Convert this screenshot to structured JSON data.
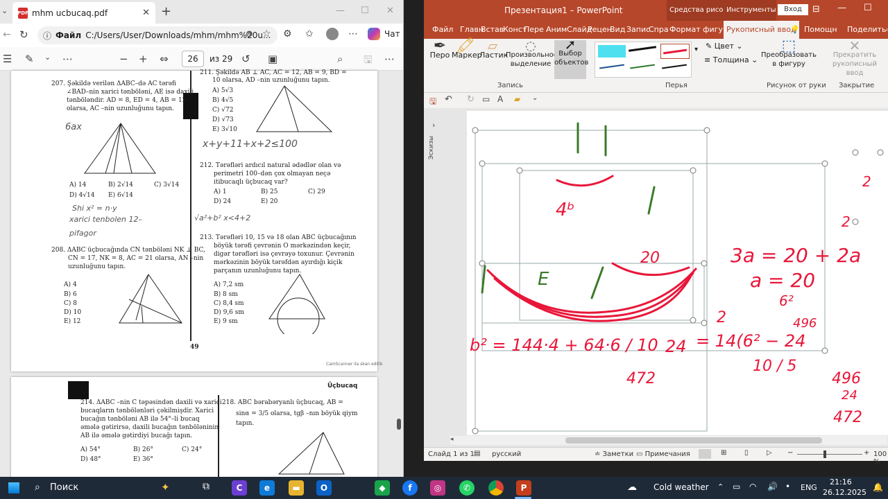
{
  "edge": {
    "tab_title": "mhm ucbucaq.pdf",
    "file_label": "Файл",
    "url": "C:/Users/User/Downloads/mhm/mhm%20u...",
    "copilot_label": "Чат",
    "page_number": "26",
    "page_total": "из 29"
  },
  "pdf": {
    "page_footer": "49",
    "scanner_note": "CamScanner ilə skan edilib",
    "next_header": "Üçbucaq",
    "q207": [
      "207. Şəkildə verilən ΔABC–də AC tərəfi",
      "∠BAD–nin xarici tənböləni, AE isə daxili",
      "tənböləndir.   AD = 8,  ED = 4,  AB = 12",
      "olarsa, AC –nin uzunluğunu tapın."
    ],
    "q207_answers": [
      "A) 14",
      "B) 2√14",
      "C) 3√14",
      "D) 4√14",
      "E) 6√14"
    ],
    "q208": [
      "208. ΔABC üçbucağında CN tənböləni NK ⊥ BC,",
      "CN = 17, NK = 8, AC = 21 olarsa, AN –nin",
      "uzunluğunu tapın."
    ],
    "q208_answers": [
      "A) 4",
      "B) 6",
      "C) 8",
      "D) 10",
      "E) 12"
    ],
    "q211": [
      "211. Şəkildə AB ⊥ AC, AC = 12, AB = 9, BD =",
      "10 olarsa, AD –nin uzunluğunu tapın."
    ],
    "q211_answers": [
      "A) 5√3",
      "B) 4√5",
      "C) √72",
      "D) √73",
      "E) 3√10"
    ],
    "q212": [
      "212. Tərəfləri ardıcıl natural ədədlər olan və",
      "perimetri 100–dən çox olmayan neçə",
      "itibucaqlı üçbucaq var?"
    ],
    "q212_answers": [
      "A) 1",
      "B) 25",
      "C) 29",
      "D) 24",
      "E) 20"
    ],
    "q213": [
      "213. Tərəfləri 10, 15 və 18 olan ABC üçbucağının",
      "böyük tərəfi çevrənin O mərkəzindən keçir,",
      "digər tərəfləri isə çevrəyə toxunur. Çevrənin",
      "mərkəzinin böyük tərəfdən ayırdığı kiçik",
      "parçanın uzunluğunu tapın."
    ],
    "q213_answers": [
      "A) 7,2 sm",
      "B) 8 sm",
      "C) 8,4 sm",
      "D) 9,6 sm",
      "E) 9 sm"
    ],
    "q214": [
      "214. ΔABC –nin C təpəsindən daxili və xarici",
      "bucaqların tənbölənləri çəkilmişdir. Xarici",
      "bucağın tənböləni AB ilə 54°–li bucaq",
      "əmələ gətirirsə, daxili bucağın tənböləninin",
      "AB ilə əmələ gətirdiyi bucağı tapın."
    ],
    "q214_answers": [
      "A) 54°",
      "B) 26°",
      "C) 24°",
      "D) 48°",
      "E) 36°"
    ],
    "q218": [
      "218. ABC  bərabəryanlı  üçbucaq,  AB =",
      "sinα = 3/5  olarsa, tgβ –nın böyük qiym",
      "tapın."
    ],
    "handwriting": [
      "6ax",
      "Shi x² = n·y",
      "xarici tenbolen  12–",
      "pifagor",
      "x+y+11+x+2≤100",
      "√a²+b²  x<4+2"
    ]
  },
  "ppt": {
    "window_title": "Презентация1 – PowerPoint",
    "context_title_1": "Средства рисов...",
    "context_title_2": "Инструменты...",
    "signin": "Вход",
    "tabs": [
      "Файл",
      "Главн",
      "Встав",
      "Конст",
      "Пере",
      "Аним",
      "Слайд",
      "Рецен",
      "Вид",
      "Запис",
      "Спра",
      "Формат фигуры",
      "Рукописный ввод"
    ],
    "help": "Помощн",
    "share": "Поделиться",
    "tools": {
      "pen": "Перо",
      "marker": "Маркер",
      "eraser": "Ластик",
      "freeform": "Произвольное выделение",
      "select": "Выбор объектов",
      "color": "Цвет",
      "thickness": "Толщина",
      "convert": "Преобразовать в фигуру",
      "stop": "Прекратить рукописный ввод"
    },
    "groups": [
      "Запись",
      "Перья",
      "Рисунок от руки",
      "Закрытие"
    ],
    "thumbnails_label": "Эскизы",
    "status_slide": "Слайд 1 из 1",
    "status_lang": "русский",
    "notes": "Заметки",
    "comments": "Примечания",
    "zoom": "100 %",
    "ink": [
      "3a = 20 + 2a",
      "a = 20",
      "6²",
      "496",
      "b² = 144·4 + 64·6 / 10",
      "24",
      "= 14(6² − 24",
      "10 / 5",
      "472",
      "2",
      "20",
      "E",
      "4ᵇ",
      "496",
      "24",
      "472",
      "2",
      "2"
    ],
    "colors": {
      "ink_red": "#e8173a",
      "ink_green": "#3a7a2a",
      "accent": "#b7472a"
    }
  },
  "taskbar": {
    "search": "Поиск",
    "weather": "Cold weather",
    "lang": "ENG",
    "time": "21:16",
    "date": "26.12.2025"
  }
}
